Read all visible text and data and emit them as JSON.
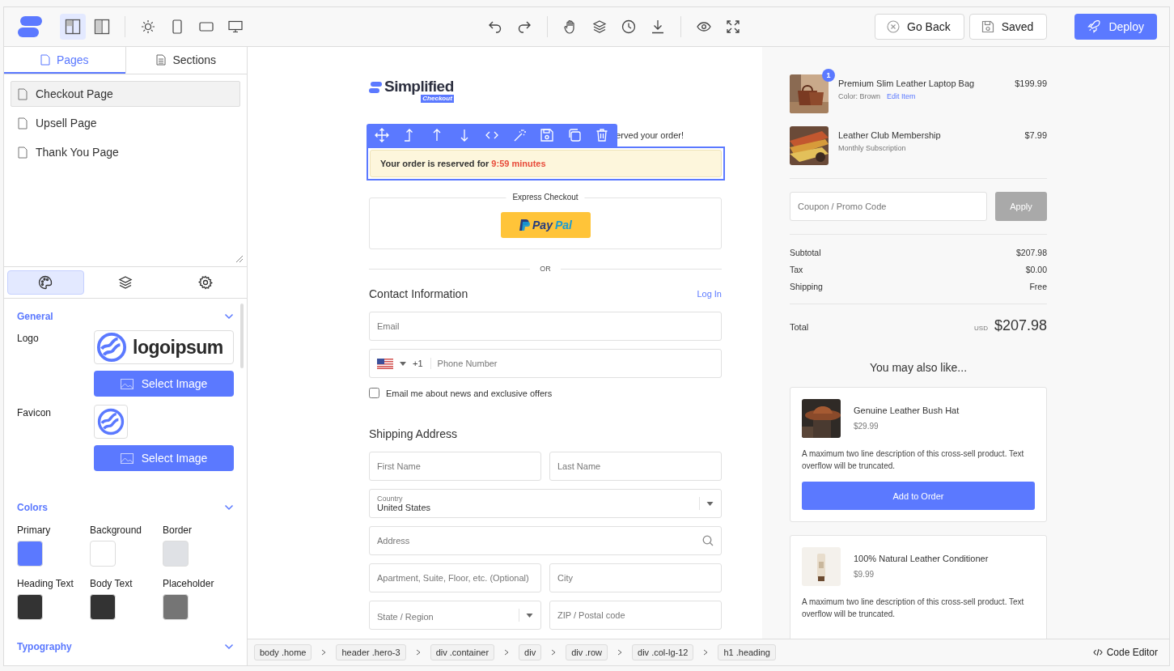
{
  "topbar": {
    "layout_toggles": [
      {
        "selected": true
      },
      {
        "selected": false
      }
    ],
    "device_toggles": [
      {
        "selected": false
      },
      {
        "selected": false
      },
      {
        "selected": false
      },
      {
        "selected": false
      }
    ],
    "go_back": "Go Back",
    "saved": "Saved",
    "deploy": "Deploy"
  },
  "left_panel": {
    "tabs": [
      {
        "label": "Pages",
        "selected": true
      },
      {
        "label": "Sections",
        "selected": false
      }
    ],
    "pages": [
      {
        "label": "Checkout Page",
        "selected": true
      },
      {
        "label": "Upsell Page",
        "selected": false
      },
      {
        "label": "Thank You Page",
        "selected": false
      }
    ],
    "panel_tabs": [
      {
        "selected": true
      },
      {
        "selected": false
      },
      {
        "selected": false
      }
    ],
    "general": {
      "title": "General",
      "expanded": true,
      "logo_label": "Logo",
      "logo_text": "logoipsum",
      "favicon_label": "Favicon",
      "select_buttons": [
        "Select Image",
        "Select Image"
      ]
    },
    "colors": {
      "title": "Colors",
      "expanded": true,
      "swatches": [
        {
          "label": "Primary",
          "color": "#5b79ff"
        },
        {
          "label": "Background",
          "color": "#ffffff"
        },
        {
          "label": "Border",
          "color": "#dfe1e5"
        },
        {
          "label": "Heading Text",
          "color": "#333333"
        },
        {
          "label": "Body Text",
          "color": "#333333"
        },
        {
          "label": "Placeholder",
          "color": "#757575"
        }
      ]
    },
    "typography": {
      "title": "Typography"
    }
  },
  "checkout": {
    "brand": "Simplified",
    "brand_sub": "Checkout",
    "heading_visible": "erved your order!",
    "timer": {
      "text": "Your order is reserved for",
      "time": "9:59 minutes"
    },
    "express": {
      "label": "Express Checkout",
      "paypal": [
        "Pay",
        "Pal"
      ]
    },
    "or": "OR",
    "contact": {
      "title": "Contact Information",
      "login": "Log In",
      "email": {
        "placeholder": "Email"
      },
      "phone_code": "+1",
      "phone": {
        "placeholder": "Phone Number"
      },
      "newsletter": {
        "label": "Email me about news and exclusive offers",
        "checked": false
      }
    },
    "shipping": {
      "title": "Shipping Address",
      "first_name": {
        "placeholder": "First Name"
      },
      "last_name": {
        "placeholder": "Last Name"
      },
      "country": {
        "label": "Country",
        "value": "United States"
      },
      "address": {
        "placeholder": "Address"
      },
      "apartment": {
        "placeholder": "Apartment, Suite, Floor, etc. (Optional)"
      },
      "city": {
        "placeholder": "City"
      },
      "state": {
        "placeholder": "State / Region"
      },
      "zip": {
        "placeholder": "ZIP / Postal code"
      }
    }
  },
  "summary": {
    "items": [
      {
        "name": "Premium Slim Leather Laptop Bag",
        "detail": "Color: Brown",
        "link": "Edit Item",
        "price": "$199.99",
        "badge": "1"
      },
      {
        "name": "Leather Club Membership",
        "detail": "Monthly Subscription",
        "price": "$7.99"
      }
    ],
    "coupon": {
      "placeholder": "Coupon / Promo Code"
    },
    "apply": {
      "label": "Apply",
      "disabled": true
    },
    "totals": [
      {
        "label": "Subtotal",
        "value": "$207.98"
      },
      {
        "label": "Tax",
        "value": "$0.00"
      },
      {
        "label": "Shipping",
        "value": "Free"
      }
    ],
    "total": {
      "label": "Total",
      "currency": "USD",
      "amount": "$207.98"
    },
    "upsell_title": "You may also like...",
    "products": [
      {
        "name": "Genuine Leather Bush Hat",
        "price": "$29.99",
        "description": "A maximum two line description of this cross-sell product. Text overflow will be truncated.",
        "button": "Add to Order"
      },
      {
        "name": "100% Natural Leather Conditioner",
        "price": "$9.99",
        "description": "A maximum two line description of this cross-sell product. Text overflow will be truncated."
      }
    ]
  },
  "breadcrumb": [
    "body .home",
    "header .hero-3",
    "div .container",
    "div",
    "div .row",
    "div .col-lg-12",
    "h1 .heading"
  ],
  "code_editor": "Code Editor"
}
